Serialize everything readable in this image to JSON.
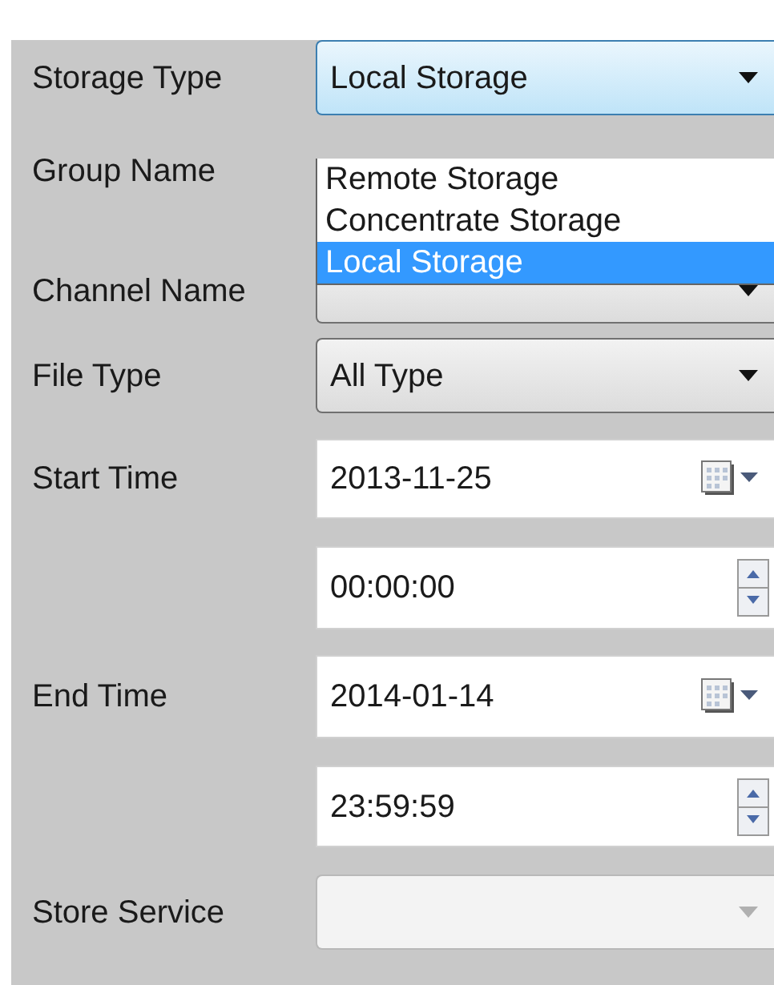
{
  "rows": [
    {
      "label": "Storage Type",
      "control": {
        "kind": "combo",
        "value": "Local Storage",
        "focused": true,
        "disabled": false
      },
      "open_list": [
        {
          "label": "Remote Storage",
          "selected": false
        },
        {
          "label": "Concentrate Storage",
          "selected": false
        },
        {
          "label": "Local Storage",
          "selected": true
        }
      ]
    },
    {
      "label": "Group Name"
    },
    {
      "label": "Channel Name",
      "control": {
        "kind": "combo",
        "focused": false,
        "disabled": false
      }
    },
    {
      "label": "File Type",
      "control": {
        "kind": "combo",
        "value": "All Type",
        "focused": false,
        "disabled": false
      }
    },
    {
      "label": "Start Time",
      "control": {
        "kind": "date",
        "value": "2013-11-25"
      }
    },
    {
      "control": {
        "kind": "time",
        "value": "00:00:00"
      }
    },
    {
      "label": "End Time",
      "control": {
        "kind": "date",
        "value": "2014-01-14"
      }
    },
    {
      "control": {
        "kind": "time",
        "value": "23:59:59"
      }
    },
    {
      "label": "Store Service",
      "control": {
        "kind": "combo",
        "disabled": true
      }
    }
  ]
}
